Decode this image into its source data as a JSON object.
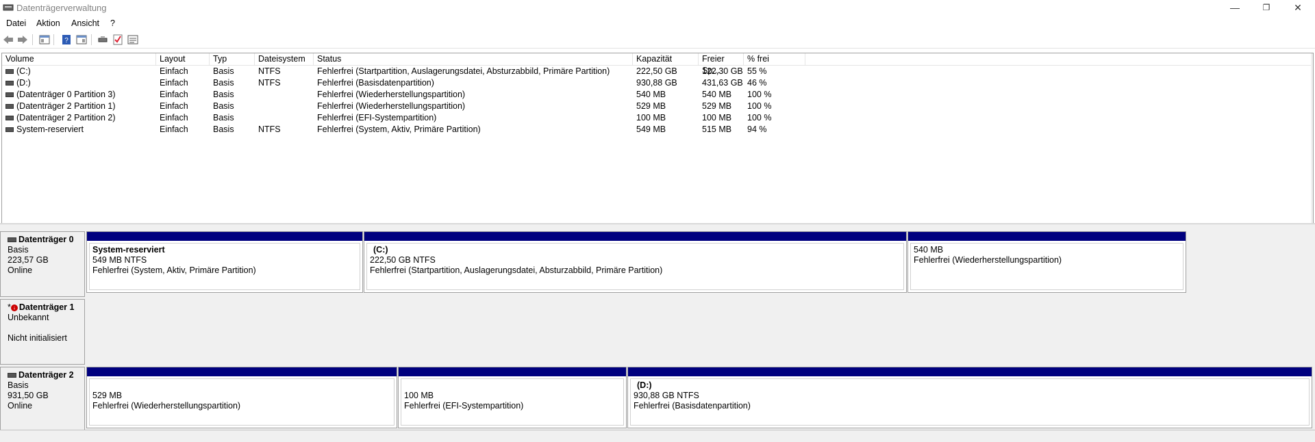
{
  "window": {
    "title": "Datenträgerverwaltung",
    "minimize": "—",
    "restore": "❐",
    "close": "✕"
  },
  "menu": [
    "Datei",
    "Aktion",
    "Ansicht",
    "?"
  ],
  "toolbar": {
    "icons": [
      "back-icon",
      "forward-icon",
      "console-tree-icon",
      "help-icon",
      "properties-icon",
      "rescan-icon",
      "checklist-icon",
      "details-icon"
    ]
  },
  "volume_list": {
    "columns": [
      "Volume",
      "Layout",
      "Typ",
      "Dateisystem",
      "Status",
      "Kapazität",
      "Freier Sp...",
      "% frei"
    ],
    "rows": [
      [
        "(C:)",
        "Einfach",
        "Basis",
        "NTFS",
        "Fehlerfrei (Startpartition, Auslagerungsdatei, Absturzabbild, Primäre Partition)",
        "222,50 GB",
        "122,30 GB",
        "55 %"
      ],
      [
        "(D:)",
        "Einfach",
        "Basis",
        "NTFS",
        "Fehlerfrei (Basisdatenpartition)",
        "930,88 GB",
        "431,63 GB",
        "46 %"
      ],
      [
        "(Datenträger 0 Partition 3)",
        "Einfach",
        "Basis",
        "",
        "Fehlerfrei (Wiederherstellungspartition)",
        "540 MB",
        "540 MB",
        "100 %"
      ],
      [
        "(Datenträger 2 Partition 1)",
        "Einfach",
        "Basis",
        "",
        "Fehlerfrei (Wiederherstellungspartition)",
        "529 MB",
        "529 MB",
        "100 %"
      ],
      [
        "(Datenträger 2 Partition 2)",
        "Einfach",
        "Basis",
        "",
        "Fehlerfrei (EFI-Systempartition)",
        "100 MB",
        "100 MB",
        "100 %"
      ],
      [
        "System-reserviert",
        "Einfach",
        "Basis",
        "NTFS",
        "Fehlerfrei (System, Aktiv, Primäre Partition)",
        "549 MB",
        "515 MB",
        "94 %"
      ]
    ]
  },
  "disks": [
    {
      "name": "Datenträger 0",
      "line1": "Basis",
      "line2": "223,57 GB",
      "line3": "Online",
      "partitions": [
        {
          "name": "System-reserviert",
          "size": "549 MB NTFS",
          "status": "Fehlerfrei (System, Aktiv, Primäre Partition)"
        },
        {
          "name": "(C:)",
          "size": "222,50 GB NTFS",
          "status": "Fehlerfrei (Startpartition, Auslagerungsdatei, Absturzabbild, Primäre Partition)"
        },
        {
          "name": "",
          "size": "540 MB",
          "status": "Fehlerfrei (Wiederherstellungspartition)"
        }
      ]
    },
    {
      "name": "Datenträger 1",
      "prefix": "*",
      "line1": "Unbekannt",
      "line2": "",
      "line3": "Nicht initialisiert",
      "partitions": []
    },
    {
      "name": "Datenträger 2",
      "line1": "Basis",
      "line2": "931,50 GB",
      "line3": "Online",
      "partitions": [
        {
          "name": "",
          "size": "529 MB",
          "status": "Fehlerfrei (Wiederherstellungspartition)"
        },
        {
          "name": "",
          "size": "100 MB",
          "status": "Fehlerfrei (EFI-Systempartition)"
        },
        {
          "name": "(D:)",
          "size": "930,88 GB NTFS",
          "status": "Fehlerfrei (Basisdatenpartition)"
        }
      ]
    }
  ],
  "colors": {
    "partition_bar": "#00007f",
    "error_icon": "#c00000"
  }
}
